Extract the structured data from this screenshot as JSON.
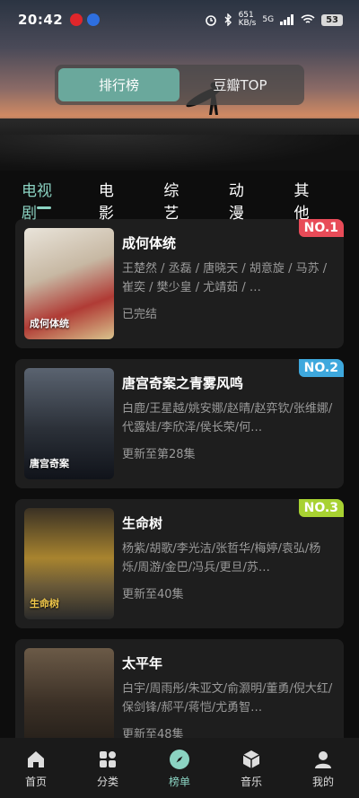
{
  "status_bar": {
    "time": "20:42",
    "speed": "651\nKB/s",
    "network": "5G",
    "battery": "53"
  },
  "segmented": {
    "options": [
      "排行榜",
      "豆瓣TOP"
    ],
    "active_index": 0
  },
  "tabs": [
    "电视剧",
    "电影",
    "综艺",
    "动漫",
    "其他"
  ],
  "active_tab": 0,
  "items": [
    {
      "rank": "NO.1",
      "rank_color": "#e84b58",
      "title": "成何体统",
      "cast": "王楚然 / 丞磊 / 唐晓天 / 胡意旋 / 马苏 / 崔奕 / 樊少皇 / 尤靖茹 / …",
      "status": "已完结"
    },
    {
      "rank": "NO.2",
      "rank_color": "#3ea8dd",
      "title": "唐宫奇案之青雾风鸣",
      "cast": "白鹿/王星越/姚安娜/赵晴/赵弈钦/张维娜/代露娃/李欣泽/侯长荣/何…",
      "status": "更新至第28集"
    },
    {
      "rank": "NO.3",
      "rank_color": "#a8d232",
      "title": "生命树",
      "cast": "杨紫/胡歌/李光洁/张哲华/梅婷/袁弘/杨烁/周游/金巴/冯兵/更旦/苏…",
      "status": "更新至40集"
    },
    {
      "rank": "",
      "rank_color": "",
      "title": "太平年",
      "cast": "白宇/周雨彤/朱亚文/俞灏明/董勇/倪大红/保剑锋/郝平/蒋恺/尤勇智…",
      "status": "更新至48集"
    }
  ],
  "nav": [
    {
      "label": "首页",
      "icon": "home-icon"
    },
    {
      "label": "分类",
      "icon": "grid-icon"
    },
    {
      "label": "榜单",
      "icon": "compass-icon"
    },
    {
      "label": "音乐",
      "icon": "box-icon"
    },
    {
      "label": "我的",
      "icon": "user-icon"
    }
  ],
  "active_nav": 2
}
